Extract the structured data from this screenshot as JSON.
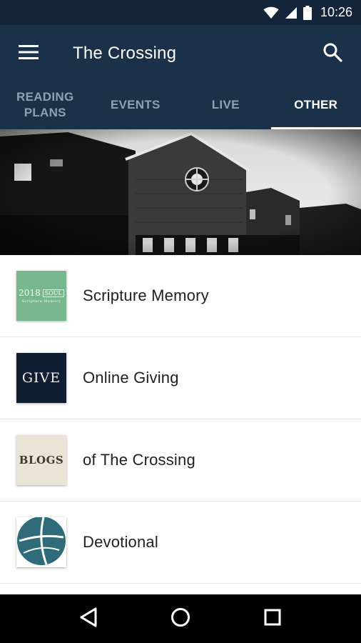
{
  "status_bar": {
    "time": "10:26",
    "icons": [
      "wifi-icon",
      "signal-icon",
      "battery-icon"
    ]
  },
  "app_bar": {
    "title": "The Crossing",
    "menu_icon": "hamburger-menu-icon",
    "search_icon": "search-icon"
  },
  "tabs": [
    {
      "label": "READING\nPLANS",
      "active": false
    },
    {
      "label": "EVENTS",
      "active": false
    },
    {
      "label": "LIVE",
      "active": false
    },
    {
      "label": "OTHER",
      "active": true
    }
  ],
  "hero": {
    "alt_icon": "church-building-image"
  },
  "list": [
    {
      "label": "Scripture Memory",
      "thumb_year": "2018",
      "thumb_box": "SOUL",
      "thumb_sub": "Scripture Memory"
    },
    {
      "label": "Online Giving",
      "thumb_text": "GIVE"
    },
    {
      "label": "of The Crossing",
      "thumb_text": "BLOGS"
    },
    {
      "label": "Devotional",
      "thumb_icon": "crossing-logo-icon"
    }
  ],
  "nav_bar": {
    "back_icon": "back-triangle-icon",
    "home_icon": "home-circle-icon",
    "recents_icon": "recents-square-icon"
  },
  "colors": {
    "status_bar": "#14243a",
    "app_bar": "#1b3049",
    "tab_inactive": "#8ea0b5",
    "tab_active": "#ffffff",
    "scripture_green": "#78b68e",
    "give_navy": "#0f1e33",
    "devotional_teal": "#2f6b78"
  }
}
